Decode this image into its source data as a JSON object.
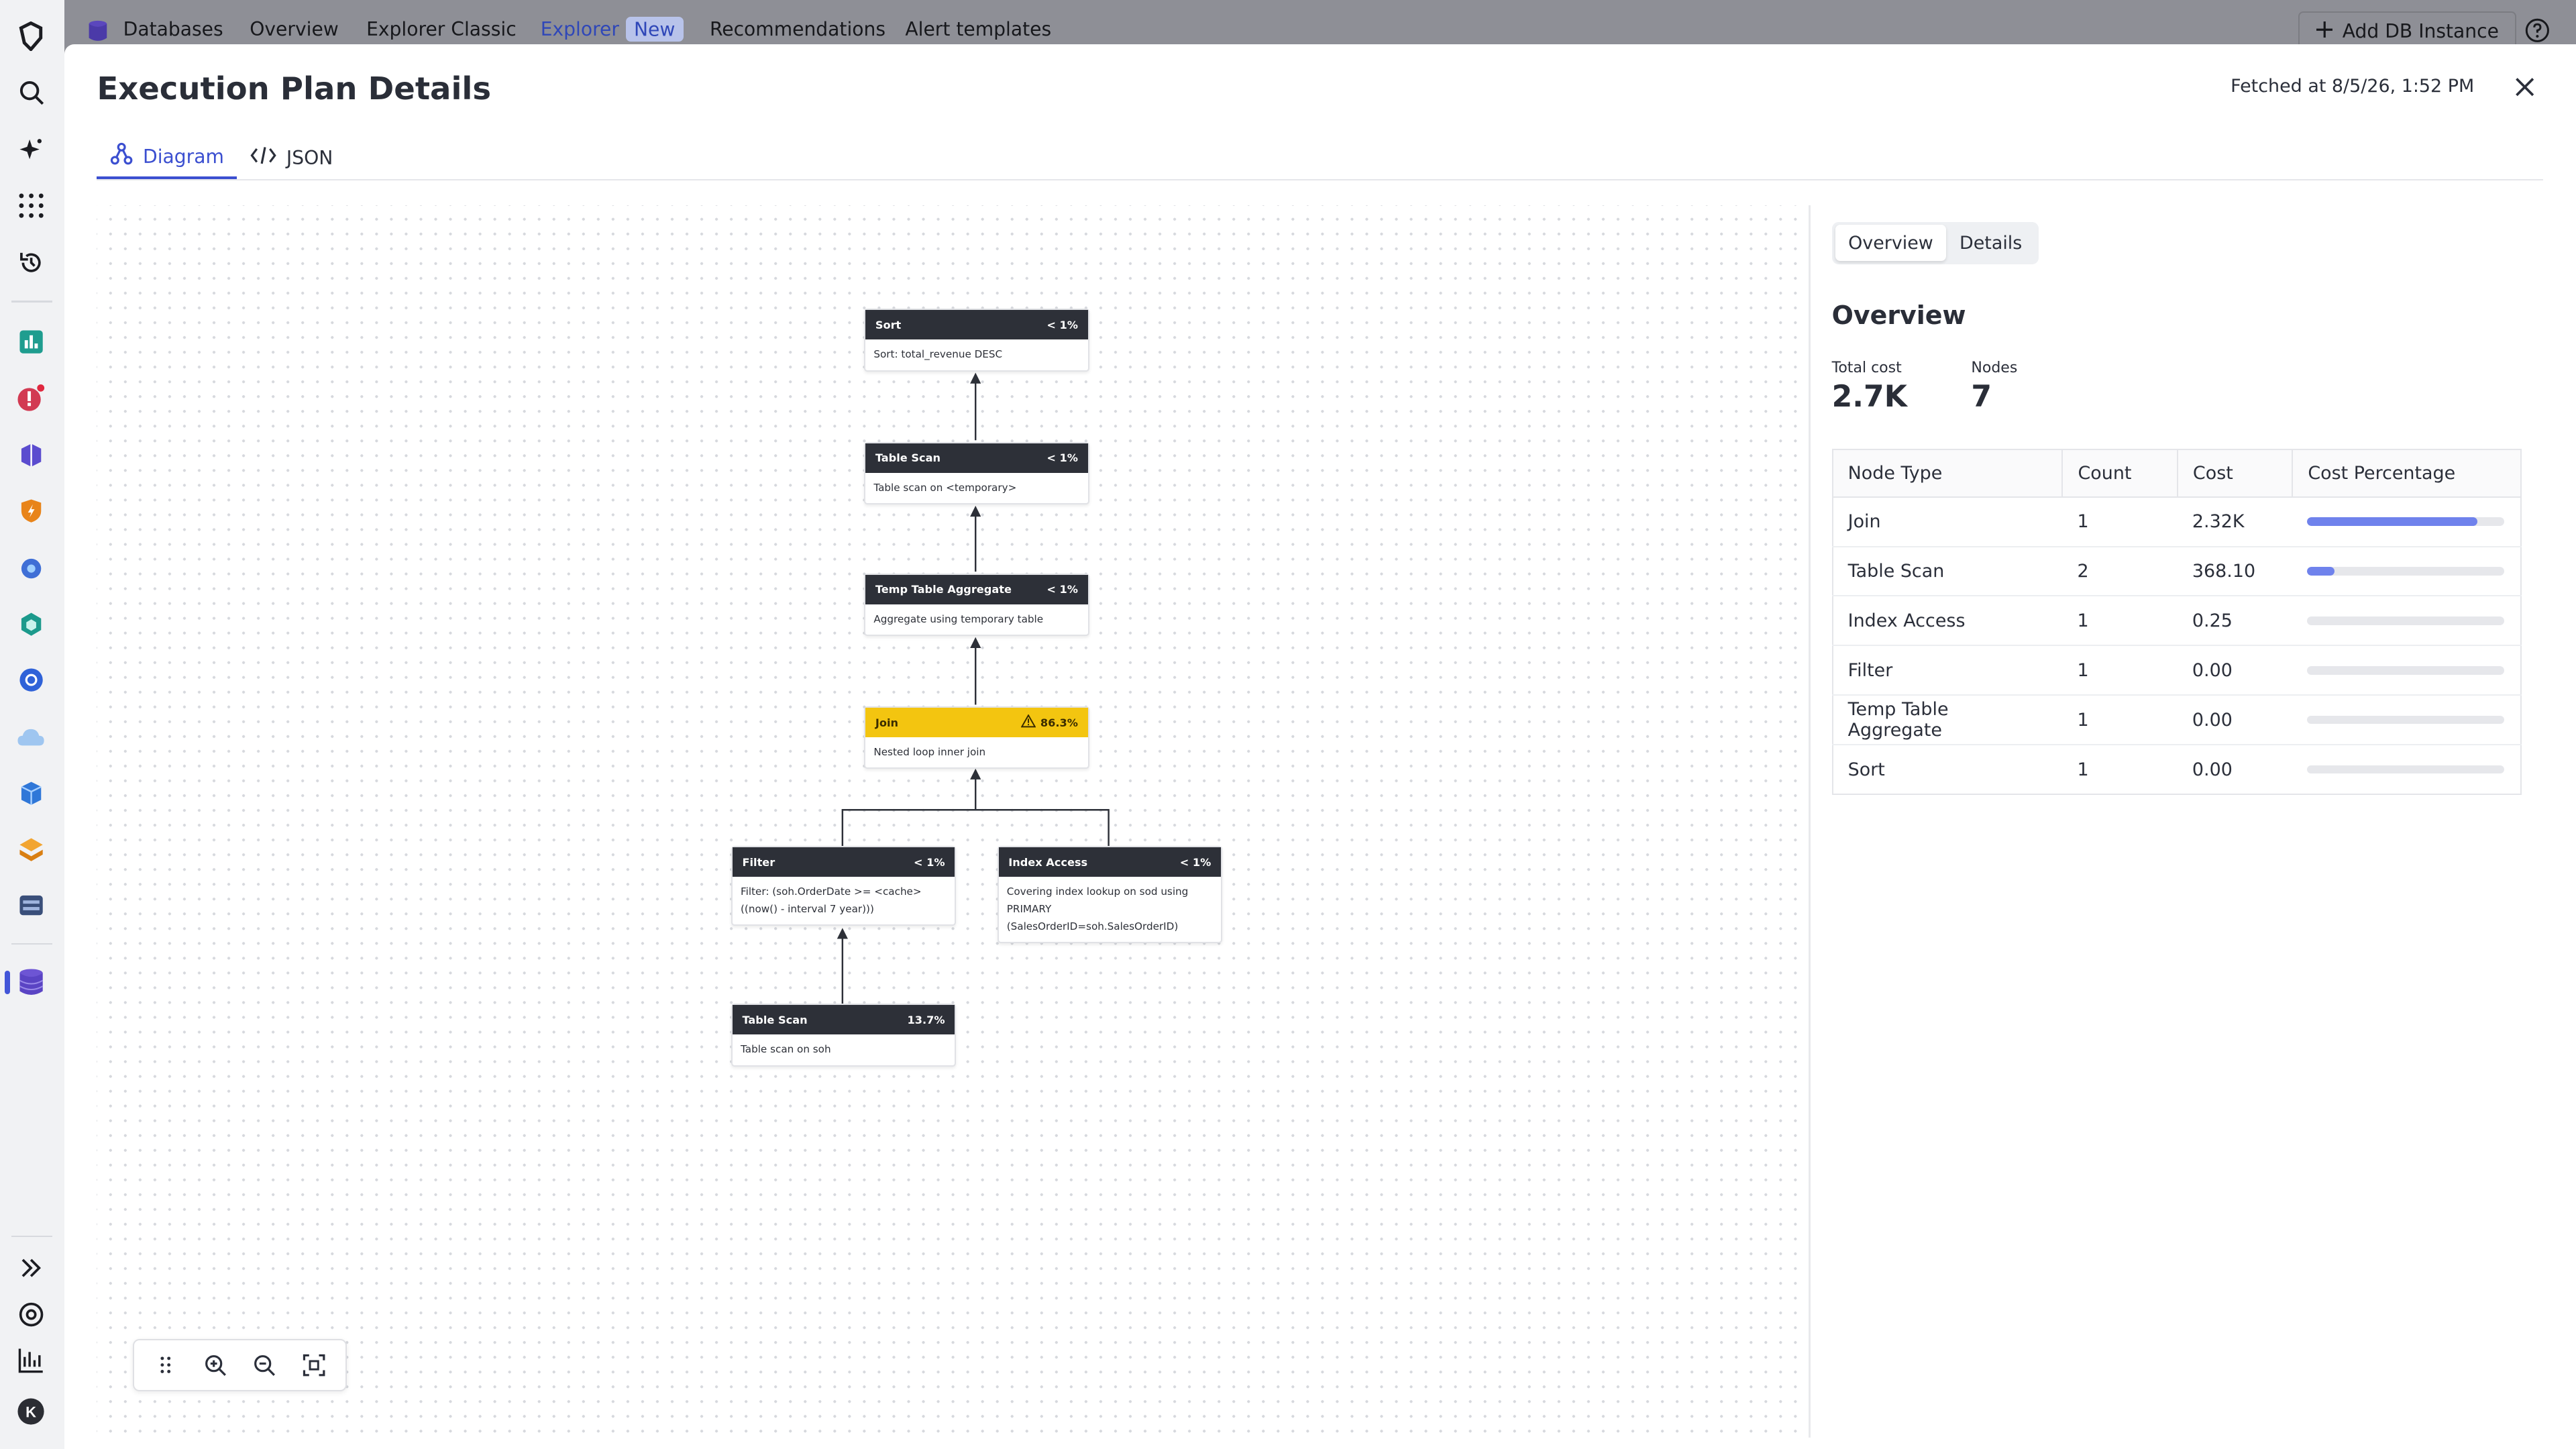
{
  "topnav": {
    "items": [
      "Databases",
      "Overview",
      "Explorer Classic",
      "Explorer",
      "Recommendations",
      "Alert templates"
    ],
    "new_badge": "New",
    "add_button": "Add DB Instance"
  },
  "modal": {
    "title": "Execution Plan Details",
    "fetched": "Fetched at 8/5/26, 1:52 PM",
    "tabs": [
      {
        "label": "Diagram",
        "icon": "diagram-icon",
        "active": true
      },
      {
        "label": "JSON",
        "icon": "code-icon",
        "active": false
      }
    ]
  },
  "plan": {
    "nodes": [
      {
        "title": "Sort",
        "pct": "< 1%",
        "desc": "Sort: total_revenue DESC"
      },
      {
        "title": "Table Scan",
        "pct": "< 1%",
        "desc": "Table scan on <temporary>"
      },
      {
        "title": "Temp Table Aggregate",
        "pct": "< 1%",
        "desc": "Aggregate using temporary table"
      },
      {
        "title": "Join",
        "pct": "86.3%",
        "desc": "Nested loop inner join",
        "warning": true
      },
      {
        "title": "Filter",
        "pct": "< 1%",
        "desc": "Filter: (soh.OrderDate >= <cache>((now() - interval 7 year)))"
      },
      {
        "title": "Index Access",
        "pct": "< 1%",
        "desc": "Covering index lookup on sod using PRIMARY (SalesOrderID=soh.SalesOrderID)"
      },
      {
        "title": "Table Scan",
        "pct": "13.7%",
        "desc": "Table scan on soh"
      }
    ]
  },
  "panel": {
    "seg": [
      "Overview",
      "Details"
    ],
    "heading": "Overview",
    "total_cost_label": "Total cost",
    "total_cost": "2.7K",
    "nodes_label": "Nodes",
    "nodes": "7",
    "columns": [
      "Node Type",
      "Count",
      "Cost",
      "Cost Percentage"
    ],
    "rows": [
      {
        "type": "Join",
        "count": "1",
        "cost": "2.32K",
        "fraction": 0.863
      },
      {
        "type": "Table Scan",
        "count": "2",
        "cost": "368.10",
        "fraction": 0.137
      },
      {
        "type": "Index Access",
        "count": "1",
        "cost": "0.25",
        "fraction": 0.0
      },
      {
        "type": "Filter",
        "count": "1",
        "cost": "0.00",
        "fraction": 0.0
      },
      {
        "type": "Temp Table Aggregate",
        "count": "1",
        "cost": "0.00",
        "fraction": 0.0
      },
      {
        "type": "Sort",
        "count": "1",
        "cost": "0.00",
        "fraction": 0.0
      }
    ]
  },
  "colors": {
    "accent": "#3b4fd0",
    "bar": "#6f82ec",
    "warn": "#f3c510",
    "node_header": "#2d3038"
  }
}
